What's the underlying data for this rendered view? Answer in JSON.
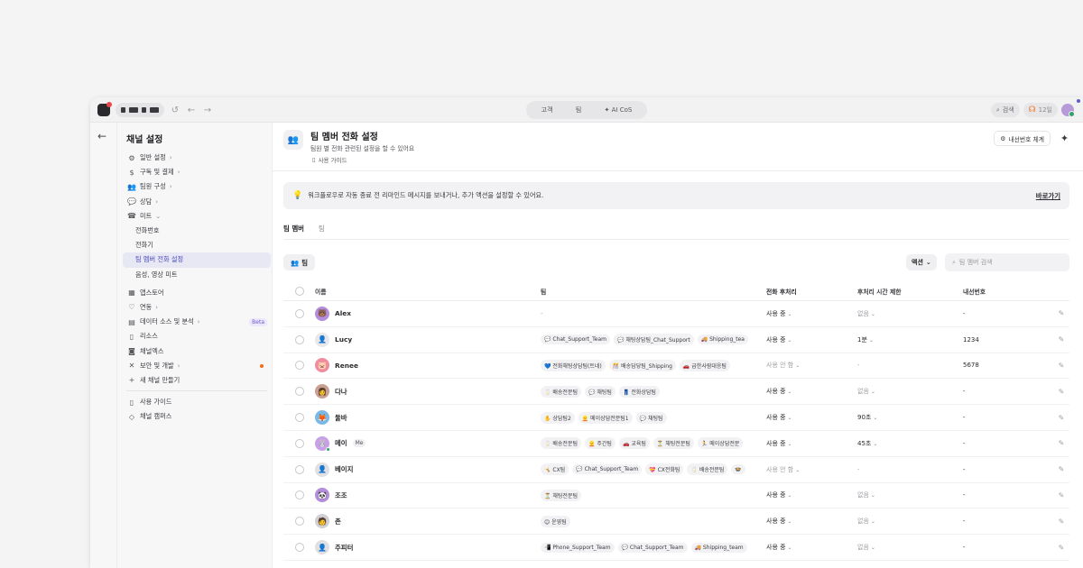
{
  "topbar": {
    "tabs": [
      "고객",
      "팀",
      "✦ AI CoS"
    ],
    "search_label": "검색",
    "call_count": "12일"
  },
  "sidebar": {
    "title": "채널 설정",
    "items": [
      {
        "icon": "⚙",
        "label": "일반 설정",
        "chev": "›"
      },
      {
        "icon": "$",
        "label": "구독 및 결제",
        "chev": "›"
      },
      {
        "icon": "👥",
        "label": "팀원 구성",
        "chev": "›"
      },
      {
        "icon": "💬",
        "label": "상담",
        "chev": "›"
      },
      {
        "icon": "☎",
        "label": "미트",
        "chev": "⌄"
      }
    ],
    "sub_items": [
      "전화번호",
      "전화기",
      "팀 멤버 전화 설정",
      "음성, 영상 미트"
    ],
    "items2": [
      {
        "icon": "▦",
        "label": "앱스토어",
        "chev": ""
      },
      {
        "icon": "♡",
        "label": "연동",
        "chev": "›"
      },
      {
        "icon": "▤",
        "label": "데이터 소스 및 분석",
        "chev": "›",
        "badge": "Beta"
      },
      {
        "icon": "▯",
        "label": "리소스",
        "chev": ""
      },
      {
        "icon": "◙",
        "label": "채널엑스",
        "chev": ""
      },
      {
        "icon": "✕",
        "label": "보안 및 개발",
        "chev": "›",
        "dot": true
      },
      {
        "icon": "+",
        "label": "새 채널 만들기",
        "chev": ""
      }
    ],
    "items3": [
      {
        "icon": "▯",
        "label": "사용 가이드"
      },
      {
        "icon": "◇",
        "label": "채널 캠퍼스"
      }
    ]
  },
  "header": {
    "title": "팀 멤버 전화 설정",
    "subtitle": "팀원 별 전화 관련된 설정을 할 수 있어요",
    "guide": "사용 가이드",
    "ext_button": "내선번호 체계"
  },
  "banner": {
    "text": "워크플로우로 자동 종료 전 리마인드 메시지를 보내거나, 추가 액션을 설정할 수 있어요.",
    "link": "바로가기"
  },
  "tabs": [
    "팀 멤버",
    "팀"
  ],
  "toolbar": {
    "team_filter": "팀",
    "action": "액션",
    "search_placeholder": "팀 멤버 검색"
  },
  "table": {
    "headers": [
      "이름",
      "팀",
      "전화 후처리",
      "후처리 시간 제한",
      "내선번호"
    ],
    "rows": [
      {
        "name": "Alex",
        "avatar": "🐻",
        "avatar_bg": "#b48cdc",
        "teams": [],
        "teams_text": "-",
        "proc": "사용 중",
        "proc_muted": false,
        "time": "없음",
        "time_muted": true,
        "ext": "-"
      },
      {
        "name": "Lucy",
        "avatar": "👤",
        "avatar_bg": "#e8e8ea",
        "teams": [
          "💬 Chat_Support_Team",
          "💬 채팅상담팀_Chat_Support",
          "🚚 Shipping_tea"
        ],
        "proc": "사용 중",
        "proc_muted": false,
        "time": "1분",
        "time_muted": false,
        "ext": "1234"
      },
      {
        "name": "Renee",
        "avatar": "🐷",
        "avatar_bg": "#f08ca0",
        "teams": [
          "💙 전화채팅상담팀(트네)",
          "🎊 배송담당팀_Shipping",
          "🚗 급한사람대응팀"
        ],
        "proc": "사용 안 함",
        "proc_muted": true,
        "time": "-",
        "time_muted": true,
        "ext": "5678"
      },
      {
        "name": "다나",
        "avatar": "👩",
        "avatar_bg": "#c8a090",
        "teams": [
          "🥛 배송전문팀",
          "💬 채팅팀",
          "👖 전화상담팀"
        ],
        "proc": "사용 중",
        "proc_muted": false,
        "time": "없음",
        "time_muted": true,
        "ext": "-"
      },
      {
        "name": "둘바",
        "avatar": "🦊",
        "avatar_bg": "#7ab8e8",
        "teams": [
          "✋ 상담팀2",
          "👱 메이상담전문팀1",
          "💬 채팅팀"
        ],
        "proc": "사용 중",
        "proc_muted": false,
        "time": "90초",
        "time_muted": false,
        "ext": "-"
      },
      {
        "name": "메이",
        "me": "Me",
        "avatar": "🐰",
        "avatar_bg": "#c8a0e8",
        "online": true,
        "teams": [
          "🥛 배송전문팀",
          "👱 주간팀",
          "🚗 교육팀",
          "⏳ 채팅전문팀",
          "🏃 메이상담전문"
        ],
        "proc": "사용 중",
        "proc_muted": false,
        "time": "45초",
        "time_muted": false,
        "ext": "-"
      },
      {
        "name": "베이지",
        "avatar": "👤",
        "avatar_bg": "#e0e0e2",
        "teams": [
          "🤸 CX팀",
          "💬 Chat_Support_Team",
          "💝 CX전화팀",
          "🥛 배송전문팀",
          "🍲"
        ],
        "proc": "사용 안 함",
        "proc_muted": true,
        "time": "-",
        "time_muted": true,
        "ext": "-"
      },
      {
        "name": "조조",
        "avatar": "🐼",
        "avatar_bg": "#b48cdc",
        "teams": [
          "⏳ 채팅전문팀"
        ],
        "proc": "사용 중",
        "proc_muted": false,
        "time": "없음",
        "time_muted": true,
        "ext": "-"
      },
      {
        "name": "존",
        "avatar": "🧑",
        "avatar_bg": "#d0d0d4",
        "teams": [
          "😊 운영팀"
        ],
        "proc": "사용 중",
        "proc_muted": false,
        "time": "없음",
        "time_muted": true,
        "ext": "-"
      },
      {
        "name": "주피터",
        "avatar": "👤",
        "avatar_bg": "#e0e0e2",
        "teams": [
          "📲 Phone_Support_Team",
          "💬 Chat_Support_Team",
          "🚚 Shipping_team"
        ],
        "proc": "사용 중",
        "proc_muted": false,
        "time": "없음",
        "time_muted": true,
        "ext": "-"
      }
    ]
  }
}
